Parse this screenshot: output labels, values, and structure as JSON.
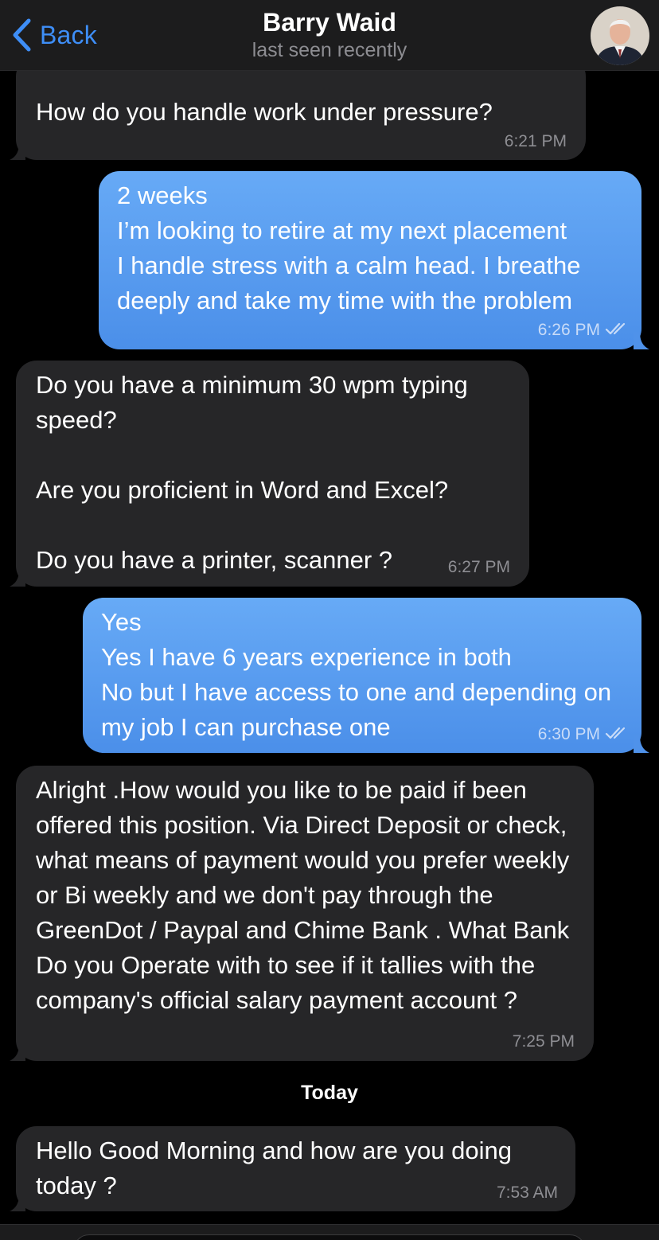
{
  "header": {
    "back_label": "Back",
    "contact_name": "Barry Waid",
    "status": "last seen recently"
  },
  "colors": {
    "incoming_bubble": "#262628",
    "outgoing_bubble": "#5b9cef",
    "accent": "#3e8ef7"
  },
  "messages": [
    {
      "direction": "incoming",
      "text": "How do you handle work under pressure?",
      "time": "6:21 PM"
    },
    {
      "direction": "outgoing",
      "text": "2 weeks\nI’m looking to retire at my next placement\nI handle stress with a calm head. I breathe deeply and take my time with the problem",
      "time": "6:26 PM",
      "read": true
    },
    {
      "direction": "incoming",
      "text": "Do you have a minimum 30 wpm typing speed?\n\nAre you proficient in Word and Excel?\n\nDo you have a printer, scanner ?",
      "time": "6:27 PM"
    },
    {
      "direction": "outgoing",
      "text": "Yes\nYes I have 6 years experience in both\nNo but I have access to one and depending on my job I can purchase one",
      "time": "6:30 PM",
      "read": true
    },
    {
      "direction": "incoming",
      "text": "Alright .How would you like to be paid if been offered this position. Via Direct Deposit or check, what means of payment would you prefer weekly or Bi weekly and we don't pay through the GreenDot / Paypal and Chime Bank . What Bank Do you Operate with to see if it tallies with the company's official salary payment account ?",
      "time": "7:25 PM"
    },
    {
      "direction": "incoming",
      "text": "Hello Good Morning and how are you doing today ?",
      "time": "7:53 AM"
    }
  ],
  "date_separator": "Today"
}
